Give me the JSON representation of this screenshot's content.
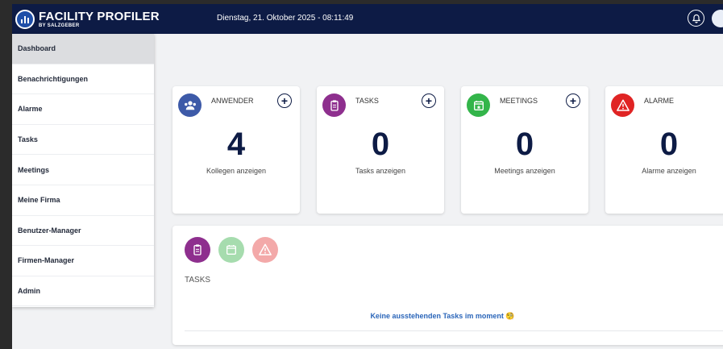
{
  "header": {
    "logo_title": "FACILITY PROFILER",
    "logo_subtitle": "BY SALZGEBER",
    "datetime": "Dienstag, 21. Oktober 2025 - 08:11:49",
    "colors": {
      "bar": "#0d1b45"
    }
  },
  "sidebar": {
    "items": [
      {
        "label": "Dashboard",
        "active": true
      },
      {
        "label": "Benachrichtigungen"
      },
      {
        "label": "Alarme"
      },
      {
        "label": "Tasks"
      },
      {
        "label": "Meetings"
      },
      {
        "label": "Meine Firma"
      },
      {
        "label": "Benutzer-Manager"
      },
      {
        "label": "Firmen-Manager"
      },
      {
        "label": "Admin"
      }
    ]
  },
  "cards": [
    {
      "title": "ANWENDER",
      "count": "4",
      "link": "Kollegen anzeigen",
      "icon": "users-icon",
      "color": "#3d5aa8",
      "has_add": true
    },
    {
      "title": "TASKS",
      "count": "0",
      "link": "Tasks anzeigen",
      "icon": "clipboard-icon",
      "color": "#8e2f8e",
      "has_add": true
    },
    {
      "title": "MEETINGS",
      "count": "0",
      "link": "Meetings anzeigen",
      "icon": "calendar-icon",
      "color": "#33b54a",
      "has_add": true
    },
    {
      "title": "ALARME",
      "count": "0",
      "link": "Alarme anzeigen",
      "icon": "warning-icon",
      "color": "#e02424",
      "has_add": false
    }
  ],
  "panel": {
    "label": "TASKS",
    "empty_message": "Keine ausstehenden Tasks im moment",
    "empty_emoji": "🧐",
    "tabs": [
      {
        "icon": "clipboard-icon",
        "color": "#8e2f8e",
        "active": true
      },
      {
        "icon": "calendar-icon",
        "color": "#a6dcae",
        "active": false
      },
      {
        "icon": "warning-icon",
        "color": "#f3a9a9",
        "active": false
      }
    ]
  }
}
